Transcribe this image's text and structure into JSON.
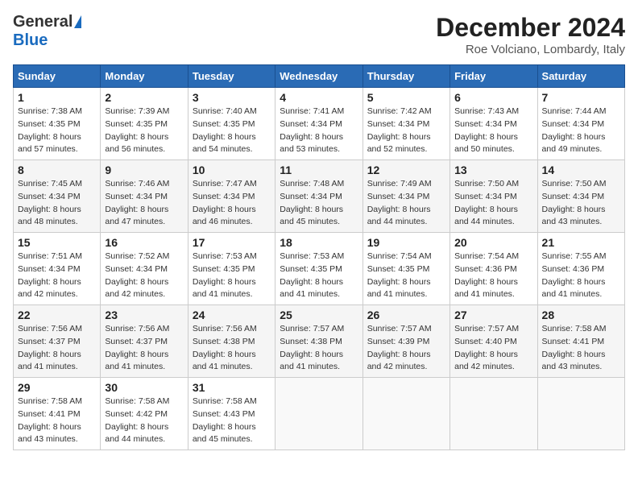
{
  "header": {
    "logo_general": "General",
    "logo_blue": "Blue",
    "month_title": "December 2024",
    "location": "Roe Volciano, Lombardy, Italy"
  },
  "days_of_week": [
    "Sunday",
    "Monday",
    "Tuesday",
    "Wednesday",
    "Thursday",
    "Friday",
    "Saturday"
  ],
  "weeks": [
    [
      {
        "day": "1",
        "sunrise": "7:38 AM",
        "sunset": "4:35 PM",
        "daylight": "8 hours and 57 minutes."
      },
      {
        "day": "2",
        "sunrise": "7:39 AM",
        "sunset": "4:35 PM",
        "daylight": "8 hours and 56 minutes."
      },
      {
        "day": "3",
        "sunrise": "7:40 AM",
        "sunset": "4:35 PM",
        "daylight": "8 hours and 54 minutes."
      },
      {
        "day": "4",
        "sunrise": "7:41 AM",
        "sunset": "4:34 PM",
        "daylight": "8 hours and 53 minutes."
      },
      {
        "day": "5",
        "sunrise": "7:42 AM",
        "sunset": "4:34 PM",
        "daylight": "8 hours and 52 minutes."
      },
      {
        "day": "6",
        "sunrise": "7:43 AM",
        "sunset": "4:34 PM",
        "daylight": "8 hours and 50 minutes."
      },
      {
        "day": "7",
        "sunrise": "7:44 AM",
        "sunset": "4:34 PM",
        "daylight": "8 hours and 49 minutes."
      }
    ],
    [
      {
        "day": "8",
        "sunrise": "7:45 AM",
        "sunset": "4:34 PM",
        "daylight": "8 hours and 48 minutes."
      },
      {
        "day": "9",
        "sunrise": "7:46 AM",
        "sunset": "4:34 PM",
        "daylight": "8 hours and 47 minutes."
      },
      {
        "day": "10",
        "sunrise": "7:47 AM",
        "sunset": "4:34 PM",
        "daylight": "8 hours and 46 minutes."
      },
      {
        "day": "11",
        "sunrise": "7:48 AM",
        "sunset": "4:34 PM",
        "daylight": "8 hours and 45 minutes."
      },
      {
        "day": "12",
        "sunrise": "7:49 AM",
        "sunset": "4:34 PM",
        "daylight": "8 hours and 44 minutes."
      },
      {
        "day": "13",
        "sunrise": "7:50 AM",
        "sunset": "4:34 PM",
        "daylight": "8 hours and 44 minutes."
      },
      {
        "day": "14",
        "sunrise": "7:50 AM",
        "sunset": "4:34 PM",
        "daylight": "8 hours and 43 minutes."
      }
    ],
    [
      {
        "day": "15",
        "sunrise": "7:51 AM",
        "sunset": "4:34 PM",
        "daylight": "8 hours and 42 minutes."
      },
      {
        "day": "16",
        "sunrise": "7:52 AM",
        "sunset": "4:34 PM",
        "daylight": "8 hours and 42 minutes."
      },
      {
        "day": "17",
        "sunrise": "7:53 AM",
        "sunset": "4:35 PM",
        "daylight": "8 hours and 41 minutes."
      },
      {
        "day": "18",
        "sunrise": "7:53 AM",
        "sunset": "4:35 PM",
        "daylight": "8 hours and 41 minutes."
      },
      {
        "day": "19",
        "sunrise": "7:54 AM",
        "sunset": "4:35 PM",
        "daylight": "8 hours and 41 minutes."
      },
      {
        "day": "20",
        "sunrise": "7:54 AM",
        "sunset": "4:36 PM",
        "daylight": "8 hours and 41 minutes."
      },
      {
        "day": "21",
        "sunrise": "7:55 AM",
        "sunset": "4:36 PM",
        "daylight": "8 hours and 41 minutes."
      }
    ],
    [
      {
        "day": "22",
        "sunrise": "7:56 AM",
        "sunset": "4:37 PM",
        "daylight": "8 hours and 41 minutes."
      },
      {
        "day": "23",
        "sunrise": "7:56 AM",
        "sunset": "4:37 PM",
        "daylight": "8 hours and 41 minutes."
      },
      {
        "day": "24",
        "sunrise": "7:56 AM",
        "sunset": "4:38 PM",
        "daylight": "8 hours and 41 minutes."
      },
      {
        "day": "25",
        "sunrise": "7:57 AM",
        "sunset": "4:38 PM",
        "daylight": "8 hours and 41 minutes."
      },
      {
        "day": "26",
        "sunrise": "7:57 AM",
        "sunset": "4:39 PM",
        "daylight": "8 hours and 42 minutes."
      },
      {
        "day": "27",
        "sunrise": "7:57 AM",
        "sunset": "4:40 PM",
        "daylight": "8 hours and 42 minutes."
      },
      {
        "day": "28",
        "sunrise": "7:58 AM",
        "sunset": "4:41 PM",
        "daylight": "8 hours and 43 minutes."
      }
    ],
    [
      {
        "day": "29",
        "sunrise": "7:58 AM",
        "sunset": "4:41 PM",
        "daylight": "8 hours and 43 minutes."
      },
      {
        "day": "30",
        "sunrise": "7:58 AM",
        "sunset": "4:42 PM",
        "daylight": "8 hours and 44 minutes."
      },
      {
        "day": "31",
        "sunrise": "7:58 AM",
        "sunset": "4:43 PM",
        "daylight": "8 hours and 45 minutes."
      },
      null,
      null,
      null,
      null
    ]
  ],
  "labels": {
    "sunrise": "Sunrise:",
    "sunset": "Sunset:",
    "daylight": "Daylight:"
  }
}
